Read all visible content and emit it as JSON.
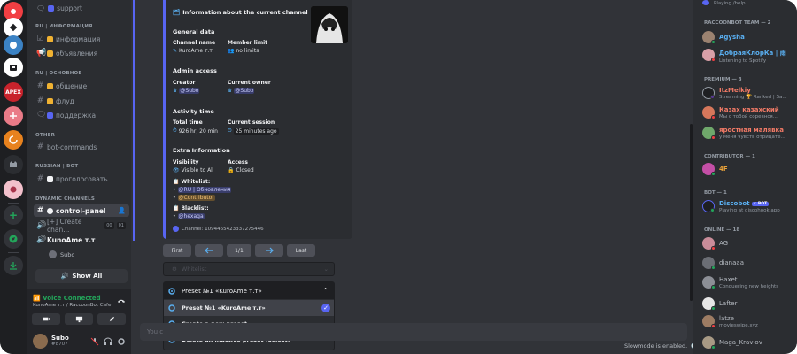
{
  "channels": {
    "support": "support",
    "cat_ru_info": "RU | ИНФОРМАЦИЯ",
    "information": "информация",
    "announcements": "объявления",
    "cat_ru_main": "RU | ОСНОВНОЕ",
    "general": "общение",
    "flood": "флуд",
    "help": "поддержка",
    "cat_other": "OTHER",
    "bot_commands": "bot-commands",
    "cat_russian_bot": "RUSSIAN | BOT",
    "vote": "проголосовать",
    "cat_dynamic": "DYNAMIC CHANNELS",
    "control_panel": "control-panel",
    "create_channel": "[+] Create chan...",
    "create_count_a": "00",
    "create_count_b": "01",
    "voice_channel": "KunoAme т.т",
    "voice_user": "Subo",
    "show_all": "Show All"
  },
  "voice_panel": {
    "title": "Voice Connected",
    "subtitle": "KunoAme т.т / RaccoonBot Cafe"
  },
  "user_panel": {
    "name": "Subo",
    "tag": "#8707"
  },
  "embed": {
    "title": "Information about the current channel",
    "general_heading": "General data",
    "channel_name_label": "Channel name",
    "channel_name_value": "KuroAme т.т",
    "member_limit_label": "Member limit",
    "member_limit_value": "no limits",
    "admin_heading": "Admin access",
    "creator_label": "Creator",
    "creator_value": "@Subo",
    "owner_label": "Current owner",
    "owner_value": "@Subo",
    "activity_heading": "Activity time",
    "total_time_label": "Total time",
    "total_time_value": "926 hr, 20 min",
    "session_label": "Current session",
    "session_value": "25 minutes ago",
    "extra_heading": "Extra Information",
    "visibility_label": "Visibility",
    "visibility_value": "Visible to All",
    "access_label": "Access",
    "access_value": "Closed",
    "whitelist_label": "Whitelist:",
    "whitelist_1": "@RU | Обновления",
    "whitelist_2": "@Contributor",
    "blacklist_label": "Blacklist:",
    "blacklist_1": "@hexaga",
    "footer": "Channel: 1094465423337275446"
  },
  "pagination": {
    "first": "First",
    "page": "1/1",
    "last": "Last"
  },
  "select_placeholder": "Whitelist",
  "preset_dropdown": {
    "selected": "Preset №1 «KuroAme т.т»",
    "options": [
      "Preset №1 «KuroAme т.т»",
      "Create a new preset",
      "Delete an inactive preset (select)"
    ]
  },
  "chat_input_placeholder": "You c",
  "slowmode": "Slowmode is enabled.",
  "members": {
    "top_activity": "Playing /help",
    "team_heading": "RACCOONBOT TEAM — 2",
    "agysha": "Agysha",
    "dobraya": "ДобраяКлорКа | 雨",
    "dobraya_activity": "Listening to Spotify",
    "premium_heading": "PREMIUM — 3",
    "itzmelkiy": "ItzMelkiy",
    "itzmelkiy_activity": "Streaming 🏆 Ranked | Sa...",
    "kazah": "Казах казахский",
    "kazah_activity": "Мы с тобой соревнся...",
    "yarostnaya": "яростная малявка",
    "yarostnaya_activity": "у меня чувств отрицате...",
    "contributor_heading": "CONTRIBUTOR — 1",
    "contributor_1": "4F",
    "bot_heading": "BOT — 1",
    "discobot": "Discobot",
    "bot_badge": "✓ BOT",
    "discobot_activity": "Playing at discohook.app",
    "online_heading": "ONLINE — 18",
    "online_1": "AG",
    "online_2": "dianaaa",
    "online_3": "Haxet",
    "online_3_activity": "Conquering new heights",
    "online_4": "Lafter",
    "online_5": "latze",
    "online_5_activity": "movieswipe.xyz",
    "online_6": "Maga_Kravlov"
  },
  "colors": {
    "blurple": "#5865f2",
    "online": "#23a55a",
    "idle": "#f0b232",
    "dnd": "#f23f43",
    "premium_red": "#f47b67",
    "agysha": "#5ab0f2"
  }
}
